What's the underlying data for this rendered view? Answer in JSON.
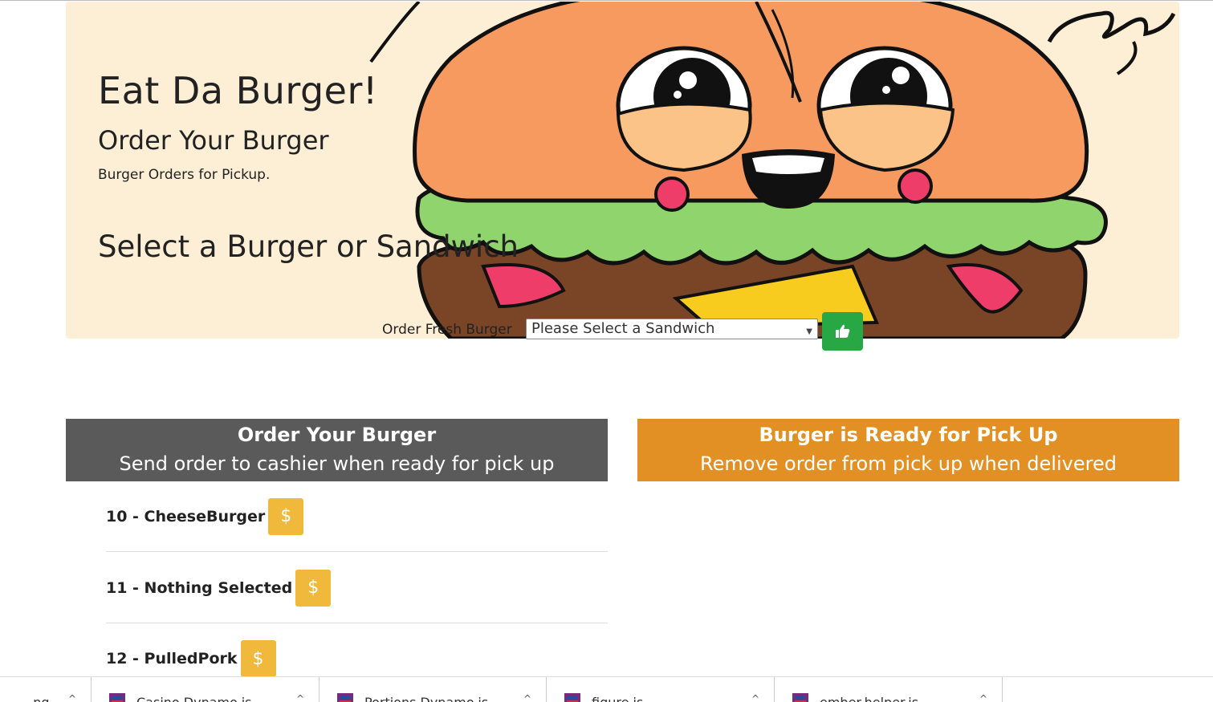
{
  "jumbotron": {
    "title": "Eat Da Burger!",
    "subtitle": "Order Your Burger",
    "lead": "Burger Orders for Pickup.",
    "select_heading": "Select a Burger or Sandwich"
  },
  "order_form": {
    "label": "Order Fresh Burger",
    "select_value": "Please Select a Sandwich",
    "submit_icon": "thumbs-up-icon"
  },
  "panels": {
    "left": {
      "heading": "Order Your Burger",
      "subheading": "Send order to cashier when ready for pick up",
      "color": "#5a5a5a"
    },
    "right": {
      "heading": "Burger is Ready for Pick Up",
      "subheading": "Remove order from pick up when delivered",
      "color": "#e29023"
    }
  },
  "orders": [
    {
      "label": "10 - CheeseBurger",
      "button": "$"
    },
    {
      "label": "11 - Nothing Selected",
      "button": "$"
    },
    {
      "label": "12 - PulledPork",
      "button": "$"
    }
  ],
  "taskbar": {
    "items": [
      {
        "label": "...ng"
      },
      {
        "label": "Casino Dynamo.js"
      },
      {
        "label": "Portions Dynamo.js"
      },
      {
        "label": "figure.js"
      },
      {
        "label": "ember.helper.js"
      }
    ]
  },
  "colors": {
    "jumbotron_bg": "#fdefd6",
    "success": "#28a745",
    "warning": "#f0b93b",
    "bun": "#f79a60",
    "lettuce": "#8fd46c"
  }
}
